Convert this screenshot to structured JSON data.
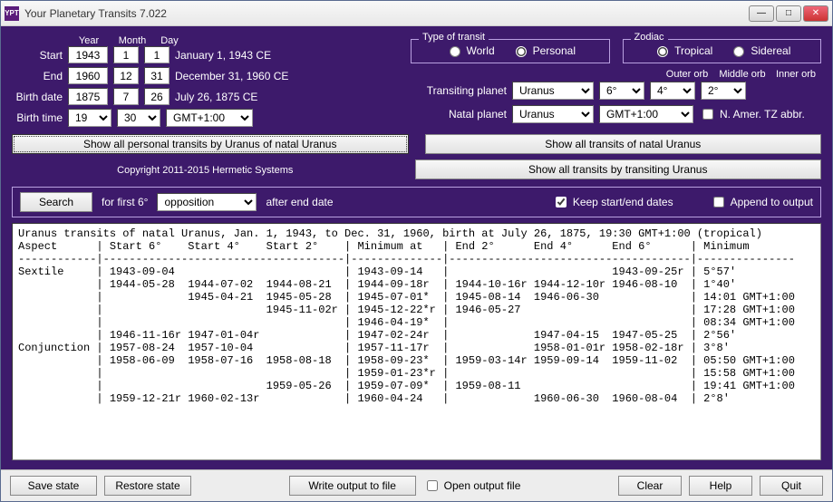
{
  "window": {
    "title": "Your Planetary Transits 7.022"
  },
  "headers": {
    "year": "Year",
    "month": "Month",
    "day": "Day"
  },
  "start": {
    "label": "Start",
    "year": "1943",
    "month": "1",
    "day": "1",
    "text": "January 1, 1943 CE"
  },
  "end": {
    "label": "End",
    "year": "1960",
    "month": "12",
    "day": "31",
    "text": "December 31, 1960 CE"
  },
  "birthdate": {
    "label": "Birth date",
    "year": "1875",
    "month": "7",
    "day": "26",
    "text": "July 26, 1875 CE"
  },
  "birthtime": {
    "label": "Birth time",
    "hour": "19",
    "minute": "30",
    "tz": "GMT+1:00"
  },
  "transit_type": {
    "legend": "Type of transit",
    "world": "World",
    "personal": "Personal",
    "selected": "personal"
  },
  "zodiac": {
    "legend": "Zodiac",
    "tropical": "Tropical",
    "sidereal": "Sidereal",
    "selected": "tropical"
  },
  "orblabels": {
    "outer": "Outer orb",
    "middle": "Middle orb",
    "inner": "Inner orb"
  },
  "transiting": {
    "label": "Transiting planet",
    "value": "Uranus",
    "outer": "6°",
    "middle": "4°",
    "inner": "2°"
  },
  "natal": {
    "label": "Natal planet",
    "value": "Uranus",
    "tz": "GMT+1:00",
    "abbr_label": "N. Amer. TZ abbr.",
    "abbr_checked": false
  },
  "buttons": {
    "show_personal": "Show all personal transits by Uranus of natal Uranus",
    "show_natal": "Show all transits of natal Uranus",
    "show_transiting": "Show all transits by transiting Uranus"
  },
  "copyright": "Copyright 2011-2015 Hermetic Systems",
  "search": {
    "btn": "Search",
    "prefix": "for first 6°",
    "aspect": "opposition",
    "suffix": "after end date",
    "keep_label": "Keep start/end dates",
    "keep_checked": true,
    "append_label": "Append to output",
    "append_checked": false
  },
  "output_text": "Uranus transits of natal Uranus, Jan. 1, 1943, to Dec. 31, 1960, birth at July 26, 1875, 19:30 GMT+1:00 (tropical)\nAspect      | Start 6°    Start 4°    Start 2°    | Minimum at   | End 2°      End 4°      End 6°      | Minimum\n------------|-------------------------------------|--------------|-------------------------------------|---------------\nSextile     | 1943-09-04                          | 1943-09-14   |                         1943-09-25r | 5°57'\n            | 1944-05-28  1944-07-02  1944-08-21  | 1944-09-18r  | 1944-10-16r 1944-12-10r 1946-08-10  | 1°40'\n            |             1945-04-21  1945-05-28  | 1945-07-01*  | 1945-08-14  1946-06-30              | 14:01 GMT+1:00\n            |                         1945-11-02r | 1945-12-22*r | 1946-05-27                          | 17:28 GMT+1:00\n            |                                     | 1946-04-19*  |                                     | 08:34 GMT+1:00\n            | 1946-11-16r 1947-01-04r             | 1947-02-24r  |             1947-04-15  1947-05-25  | 2°56'\nConjunction | 1957-08-24  1957-10-04              | 1957-11-17r  |             1958-01-01r 1958-02-18r | 3°8'\n            | 1958-06-09  1958-07-16  1958-08-18  | 1958-09-23*  | 1959-03-14r 1959-09-14  1959-11-02  | 05:50 GMT+1:00\n            |                                     | 1959-01-23*r |                                     | 15:58 GMT+1:00\n            |                         1959-05-26  | 1959-07-09*  | 1959-08-11                          | 19:41 GMT+1:00\n            | 1959-12-21r 1960-02-13r             | 1960-04-24   |             1960-06-30  1960-08-04  | 2°8'\n",
  "bottom": {
    "save": "Save state",
    "restore": "Restore state",
    "write": "Write output to file",
    "open_label": "Open output file",
    "open_checked": false,
    "clear": "Clear",
    "help": "Help",
    "quit": "Quit"
  }
}
